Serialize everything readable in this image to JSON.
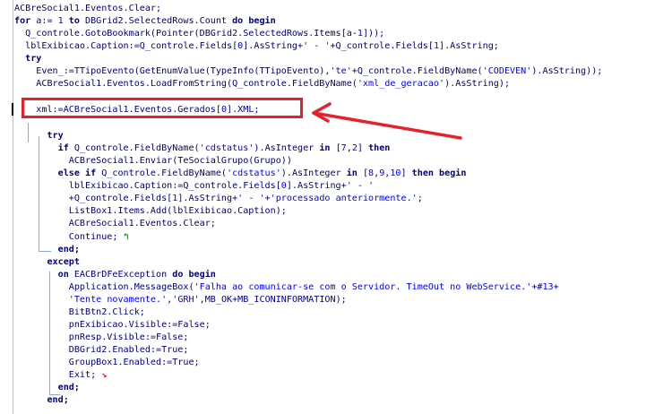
{
  "editor": {
    "lines": [
      [
        {
          "t": "ACBreSocial1.Eventos.Clear;",
          "c": "id"
        }
      ],
      [
        {
          "t": "for",
          "c": "kw"
        },
        {
          "t": " a:= ",
          "c": "id"
        },
        {
          "t": "1",
          "c": "num"
        },
        {
          "t": " to ",
          "c": "kw"
        },
        {
          "t": "DBGrid2.SelectedRows.Count ",
          "c": "id"
        },
        {
          "t": "do begin",
          "c": "kw"
        }
      ],
      [
        {
          "t": "  Q_controle.GotoBookmark(Pointer(DBGrid2.SelectedRows.Items[a-",
          "c": "id"
        },
        {
          "t": "1",
          "c": "num"
        },
        {
          "t": "]));",
          "c": "id"
        }
      ],
      [
        {
          "t": "  lblExibicao.Caption:=Q_controle.Fields[",
          "c": "id"
        },
        {
          "t": "0",
          "c": "num"
        },
        {
          "t": "].AsString+",
          "c": "id"
        },
        {
          "t": "' - '",
          "c": "str"
        },
        {
          "t": "+Q_controle.Fields[",
          "c": "id"
        },
        {
          "t": "1",
          "c": "num"
        },
        {
          "t": "].AsString;",
          "c": "id"
        }
      ],
      [
        {
          "t": "  try",
          "c": "kw"
        }
      ],
      [
        {
          "t": "    Even_:=TTipoEvento(GetEnumValue(TypeInfo(TTipoEvento),",
          "c": "id"
        },
        {
          "t": "'te'",
          "c": "str"
        },
        {
          "t": "+Q_controle.FieldByName(",
          "c": "id"
        },
        {
          "t": "'CODEVEN'",
          "c": "str"
        },
        {
          "t": ").AsString));",
          "c": "id"
        }
      ],
      [
        {
          "t": "    ACBreSocial1.Eventos.LoadFromString(Q_controle.FieldByName(",
          "c": "id"
        },
        {
          "t": "'xml_de_geracao'",
          "c": "str"
        },
        {
          "t": ").AsString);",
          "c": "id"
        }
      ],
      [],
      [
        {
          "t": "    xml:=ACBreSocial1.Eventos.Gerados[",
          "c": "id"
        },
        {
          "t": "0",
          "c": "num"
        },
        {
          "t": "].XML;",
          "c": "id"
        }
      ],
      [],
      [
        {
          "t": "      try",
          "c": "kw"
        }
      ],
      [
        {
          "t": "        if ",
          "c": "kw"
        },
        {
          "t": "Q_controle.FieldByName(",
          "c": "id"
        },
        {
          "t": "'cdstatus'",
          "c": "str"
        },
        {
          "t": ").AsInteger ",
          "c": "id"
        },
        {
          "t": "in",
          "c": "kw"
        },
        {
          "t": " [",
          "c": "id"
        },
        {
          "t": "7",
          "c": "num"
        },
        {
          "t": ",",
          "c": "id"
        },
        {
          "t": "2",
          "c": "num"
        },
        {
          "t": "] ",
          "c": "id"
        },
        {
          "t": "then",
          "c": "kw"
        }
      ],
      [
        {
          "t": "          ACBreSocial1.Enviar(TeSocialGrupo(Grupo))",
          "c": "id"
        }
      ],
      [
        {
          "t": "        else if ",
          "c": "kw"
        },
        {
          "t": "Q_controle.FieldByName(",
          "c": "id"
        },
        {
          "t": "'cdstatus'",
          "c": "str"
        },
        {
          "t": ").AsInteger ",
          "c": "id"
        },
        {
          "t": "in",
          "c": "kw"
        },
        {
          "t": " [",
          "c": "id"
        },
        {
          "t": "8",
          "c": "num"
        },
        {
          "t": ",",
          "c": "id"
        },
        {
          "t": "9",
          "c": "num"
        },
        {
          "t": ",",
          "c": "id"
        },
        {
          "t": "10",
          "c": "num"
        },
        {
          "t": "] ",
          "c": "id"
        },
        {
          "t": "then begin",
          "c": "kw"
        }
      ],
      [
        {
          "t": "          lblExibicao.Caption:=Q_controle.Fields[",
          "c": "id"
        },
        {
          "t": "0",
          "c": "num"
        },
        {
          "t": "].AsString+",
          "c": "id"
        },
        {
          "t": "' - '",
          "c": "str"
        }
      ],
      [
        {
          "t": "          +Q_controle.Fields[",
          "c": "id"
        },
        {
          "t": "1",
          "c": "num"
        },
        {
          "t": "].AsString+",
          "c": "id"
        },
        {
          "t": "' - '",
          "c": "str"
        },
        {
          "t": "+",
          "c": "id"
        },
        {
          "t": "'processado anteriormente.'",
          "c": "str"
        },
        {
          "t": ";",
          "c": "id"
        }
      ],
      [
        {
          "t": "          ListBox1.Items.Add(lblExibicao.Caption);",
          "c": "id"
        }
      ],
      [
        {
          "t": "          ACBreSocial1.Eventos.Clear;",
          "c": "id"
        }
      ],
      [
        {
          "t": "          Continue;",
          "c": "id"
        }
      ],
      [
        {
          "t": "        end;",
          "c": "kw"
        }
      ],
      [
        {
          "t": "      except",
          "c": "kw"
        }
      ],
      [
        {
          "t": "        on ",
          "c": "kw"
        },
        {
          "t": "EACBrDFeException ",
          "c": "id"
        },
        {
          "t": "do begin",
          "c": "kw"
        }
      ],
      [
        {
          "t": "          Application.MessageBox(",
          "c": "id"
        },
        {
          "t": "'Falha ao comunicar-se com o Servidor. TimeOut no WebService.'",
          "c": "str"
        },
        {
          "t": "+#",
          "c": "id"
        },
        {
          "t": "13",
          "c": "num"
        },
        {
          "t": "+",
          "c": "id"
        }
      ],
      [
        {
          "t": "          ",
          "c": "id"
        },
        {
          "t": "'Tente novamente.'",
          "c": "str"
        },
        {
          "t": ",",
          "c": "id"
        },
        {
          "t": "'GRH'",
          "c": "str"
        },
        {
          "t": ",MB_OK+MB_ICONINFORMATION);",
          "c": "id"
        }
      ],
      [
        {
          "t": "          BitBtn2.Click;",
          "c": "id"
        }
      ],
      [
        {
          "t": "          pnExibicao.Visible:=False;",
          "c": "id"
        }
      ],
      [
        {
          "t": "          pnResp.Visible:=False;",
          "c": "id"
        }
      ],
      [
        {
          "t": "          DBGrid2.Enabled:=True;",
          "c": "id"
        }
      ],
      [
        {
          "t": "          GroupBox1.Enabled:=True;",
          "c": "id"
        }
      ],
      [
        {
          "t": "          Exit;",
          "c": "id"
        }
      ],
      [
        {
          "t": "        end;",
          "c": "kw"
        }
      ],
      [
        {
          "t": "      end;",
          "c": "kw"
        }
      ]
    ],
    "markers": {
      "continue_glyph": "↰",
      "exit_glyph": "↘"
    }
  },
  "annotation": {
    "highlight_color": "#e8202a",
    "arrow_color": "#e8202a"
  }
}
